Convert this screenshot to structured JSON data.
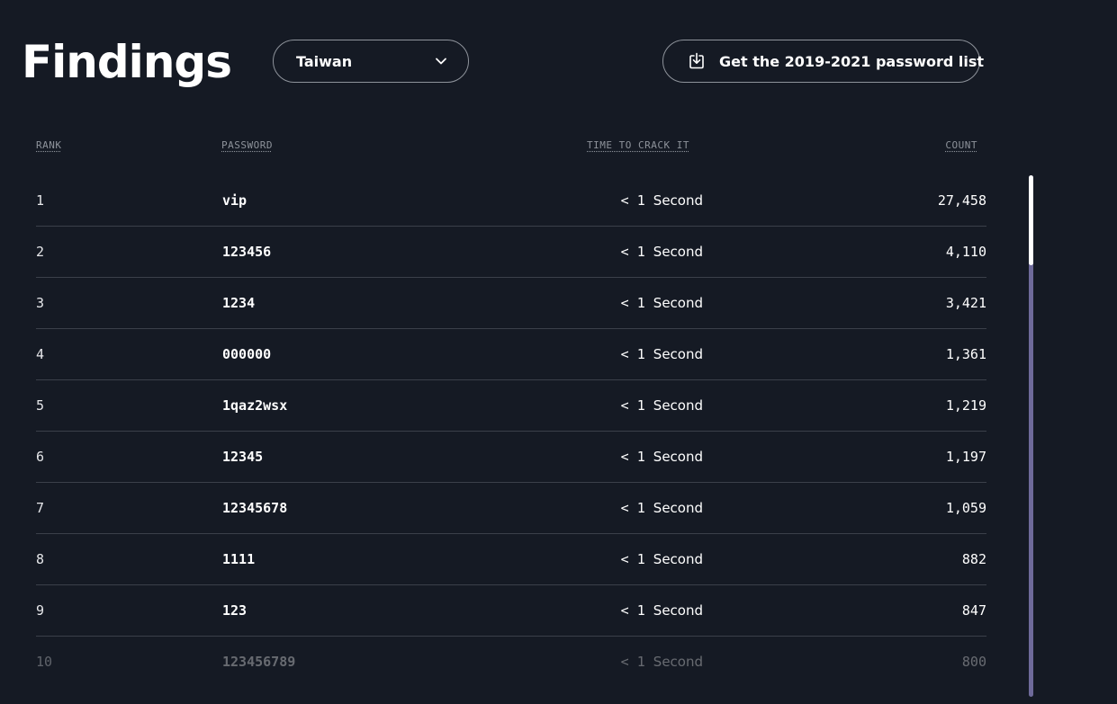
{
  "header": {
    "title": "Findings",
    "country_select": {
      "selected": "Taiwan",
      "icon": "chevron-down-icon"
    },
    "download_button": {
      "label": "Get the 2019-2021 password list",
      "icon": "download-icon"
    }
  },
  "table": {
    "columns": [
      "RANK",
      "PASSWORD",
      "TIME TO CRACK IT",
      "COUNT"
    ],
    "rows": [
      {
        "rank": "1",
        "password": "vip",
        "time_prefix": "< 1",
        "time_unit": "Second",
        "count": "27,458"
      },
      {
        "rank": "2",
        "password": "123456",
        "time_prefix": "< 1",
        "time_unit": "Second",
        "count": "4,110"
      },
      {
        "rank": "3",
        "password": "1234",
        "time_prefix": "< 1",
        "time_unit": "Second",
        "count": "3,421"
      },
      {
        "rank": "4",
        "password": "000000",
        "time_prefix": "< 1",
        "time_unit": "Second",
        "count": "1,361"
      },
      {
        "rank": "5",
        "password": "1qaz2wsx",
        "time_prefix": "< 1",
        "time_unit": "Second",
        "count": "1,219"
      },
      {
        "rank": "6",
        "password": "12345",
        "time_prefix": "< 1",
        "time_unit": "Second",
        "count": "1,197"
      },
      {
        "rank": "7",
        "password": "12345678",
        "time_prefix": "< 1",
        "time_unit": "Second",
        "count": "1,059"
      },
      {
        "rank": "8",
        "password": "1111",
        "time_prefix": "< 1",
        "time_unit": "Second",
        "count": "882"
      },
      {
        "rank": "9",
        "password": "123",
        "time_prefix": "< 1",
        "time_unit": "Second",
        "count": "847"
      },
      {
        "rank": "10",
        "password": "123456789",
        "time_prefix": "< 1",
        "time_unit": "Second",
        "count": "800"
      }
    ]
  },
  "colors": {
    "background": "#151a24",
    "text": "#ffffff",
    "muted": "#8e939b",
    "divider": "#3b404a",
    "scroll_track": "#6e6a9a",
    "scroll_thumb": "#ffffff"
  }
}
